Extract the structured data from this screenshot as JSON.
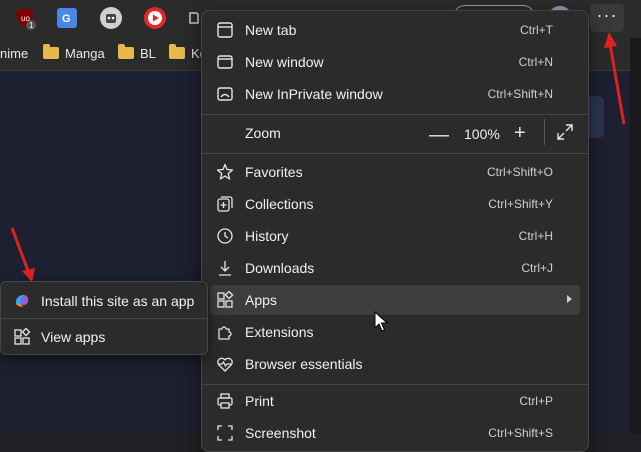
{
  "toolbar": {
    "extensions": [
      {
        "icon": "ublock-icon",
        "badge": "1"
      },
      {
        "icon": "google-translate-icon",
        "badge": "G"
      },
      {
        "icon": "robot-icon"
      },
      {
        "icon": "youtube-icon"
      },
      {
        "icon": "puzzle-icon"
      }
    ],
    "more_button_label": "···"
  },
  "bookmarks": [
    {
      "label": "nime",
      "folder": false
    },
    {
      "label": "Manga",
      "folder": true
    },
    {
      "label": "BL",
      "folder": true
    },
    {
      "label": "Ko",
      "folder": true
    }
  ],
  "menu": {
    "new_tab": {
      "label": "New tab",
      "shortcut": "Ctrl+T"
    },
    "new_window": {
      "label": "New window",
      "shortcut": "Ctrl+N"
    },
    "new_inprivate": {
      "label": "New InPrivate window",
      "shortcut": "Ctrl+Shift+N"
    },
    "zoom": {
      "label": "Zoom",
      "minus": "—",
      "value": "100%",
      "plus": "+"
    },
    "favorites": {
      "label": "Favorites",
      "shortcut": "Ctrl+Shift+O"
    },
    "collections": {
      "label": "Collections",
      "shortcut": "Ctrl+Shift+Y"
    },
    "history": {
      "label": "History",
      "shortcut": "Ctrl+H"
    },
    "downloads": {
      "label": "Downloads",
      "shortcut": "Ctrl+J"
    },
    "apps": {
      "label": "Apps"
    },
    "extensions": {
      "label": "Extensions"
    },
    "browser_essentials": {
      "label": "Browser essentials"
    },
    "print": {
      "label": "Print",
      "shortcut": "Ctrl+P"
    },
    "screenshot": {
      "label": "Screenshot",
      "shortcut": "Ctrl+Shift+S"
    }
  },
  "apps_submenu": {
    "install": {
      "label": "Install this site as an app"
    },
    "view": {
      "label": "View apps"
    }
  },
  "colors": {
    "menu_bg": "#2b2b2b",
    "hover_bg": "#3d3d3d",
    "annotation_arrow": "#e02020"
  }
}
